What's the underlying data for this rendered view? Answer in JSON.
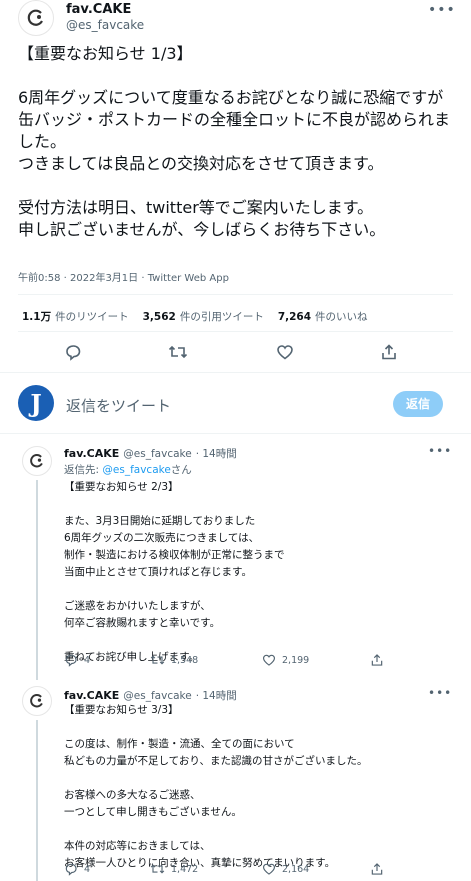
{
  "main_tweet": {
    "display_name": "fav.CAKE",
    "handle": "@es_favcake",
    "more_icon": "ellipsis-icon",
    "text": "【重要なお知らせ 1/3】\n\n6周年グッズについて度重なるお詫びとなり誠に恐縮ですが\n缶バッジ・ポストカードの全種全ロットに不良が認められました。\nつきましては良品との交換対応をさせて頂きます。\n\n受付方法は明日、twitter等でご案内いたします。\n申し訳ございませんが、今しばらくお待ち下さい。",
    "timestamp": "午前0:58 · 2022年3月1日 · Twitter Web App",
    "stats": {
      "retweets_count": "1.1万",
      "retweets_label": "件のリツイート",
      "quotes_count": "3,562",
      "quotes_label": "件の引用ツイート",
      "likes_count": "7,264",
      "likes_label": "件のいいね"
    },
    "actions": [
      "reply-icon",
      "retweet-icon",
      "like-icon",
      "share-icon"
    ]
  },
  "compose": {
    "placeholder": "返信をツイート",
    "button_label": "返信",
    "avatar_letter": "J",
    "avatar_color": "#1a5fb4"
  },
  "replies": [
    {
      "display_name": "fav.CAKE",
      "handle": "@es_favcake",
      "time": "· 14時間",
      "reply_to_prefix": "返信先: ",
      "reply_to_handle": "@es_favcake",
      "reply_to_suffix": "さん",
      "text": "【重要なお知らせ 2/3】\n\nまた、3月3日開始に延期しておりました\n6周年グッズの二次販売につきましては、\n制作・製造における検収体制が正常に整うまで\n当面中止とさせて頂ければと存じます。\n\nご迷惑をおかけいたしますが、\n何卒ご容赦賜れますと幸いです。\n\n重ねてお詫び申し上げます。",
      "reply_count": "4",
      "retweet_count": "1,548",
      "like_count": "2,199"
    },
    {
      "display_name": "fav.CAKE",
      "handle": "@es_favcake",
      "time": "· 14時間",
      "text": "【重要なお知らせ 3/3】\n\nこの度は、制作・製造・流通、全ての面において\n私どもの力量が不足しており、また認識の甘さがございました。\n\nお客様への多大なるご迷惑、\n一つとして申し開きもございません。\n\n本件の対応等におきましては、\nお客様一人ひとりに向き合い、真摯に努めてまいります。",
      "reply_count": "4",
      "retweet_count": "1,472",
      "like_count": "2,164"
    }
  ],
  "colors": {
    "accent": "#1d9bf0",
    "muted": "#536471",
    "button_disabled": "#8ecdf8"
  }
}
